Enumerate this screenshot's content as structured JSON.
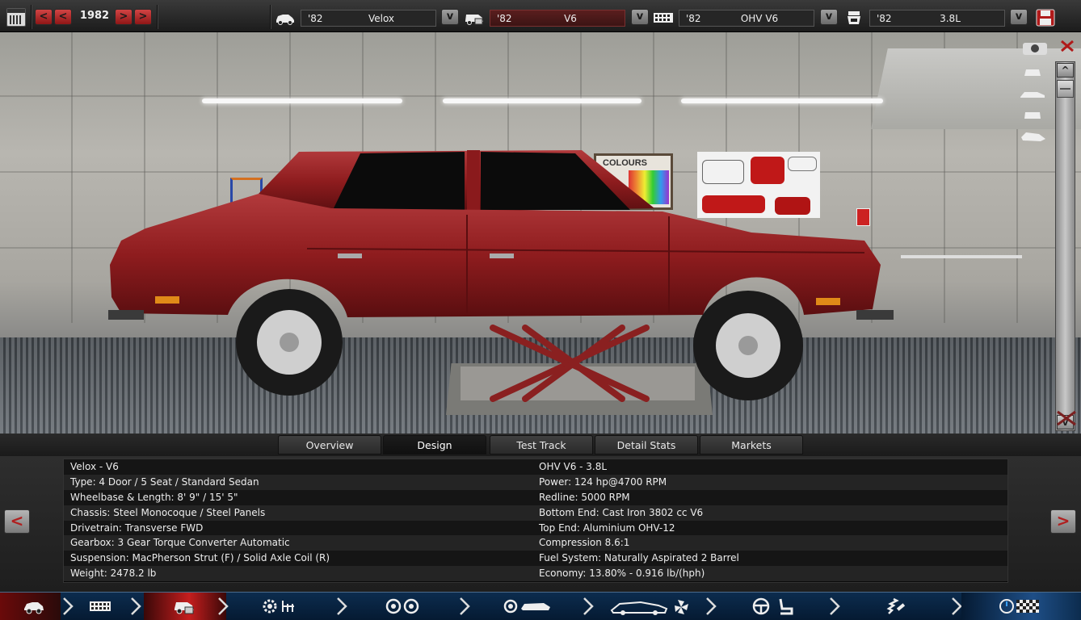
{
  "topbar": {
    "year": "1982",
    "year_prev_fast": "<",
    "year_prev": "<",
    "year_next": ">",
    "year_next_fast": ">",
    "model": {
      "year": "'82",
      "name": "Velox",
      "dropdown": "v"
    },
    "trim": {
      "year": "'82",
      "name": "V6",
      "dropdown": "v"
    },
    "engine": {
      "year": "'82",
      "name": "OHV V6",
      "dropdown": "v"
    },
    "variant": {
      "year": "'82",
      "name": "3.8L",
      "dropdown": "v"
    }
  },
  "scene": {
    "poster_text": "COLOURS",
    "car_color": "#8e1c1e",
    "scroll_up": "^",
    "scroll_down": "v"
  },
  "tabs": [
    {
      "label": "Overview",
      "active": false
    },
    {
      "label": "Design",
      "active": true
    },
    {
      "label": "Test Track",
      "active": false
    },
    {
      "label": "Detail Stats",
      "active": false
    },
    {
      "label": "Markets",
      "active": false
    }
  ],
  "info": {
    "left": [
      "Velox - V6",
      "Type: 4 Door / 5 Seat / Standard Sedan",
      "Wheelbase & Length: 8' 9\" / 15' 5\"",
      "Chassis: Steel Monocoque / Steel Panels",
      "Drivetrain: Transverse FWD",
      "Gearbox: 3 Gear Torque Converter Automatic",
      "Suspension: MacPherson Strut (F) / Solid Axle Coil (R)",
      "Weight: 2478.2 lb"
    ],
    "right": [
      "OHV V6 - 3.8L",
      "Power: 124 hp@4700 RPM",
      "Redline: 5000 RPM",
      "Bottom End: Cast Iron 3802 cc V6",
      "Top End: Aluminium OHV-12",
      "Compression 8.6:1",
      "Fuel System: Naturally Aspirated 2 Barrel",
      "Economy: 13.80% - 0.916 lb/(hph)"
    ],
    "prev_arrow": "<",
    "next_arrow": ">"
  },
  "colors": {
    "accent_red": "#c41e1e",
    "nav_blue": "#0c2c4e"
  }
}
